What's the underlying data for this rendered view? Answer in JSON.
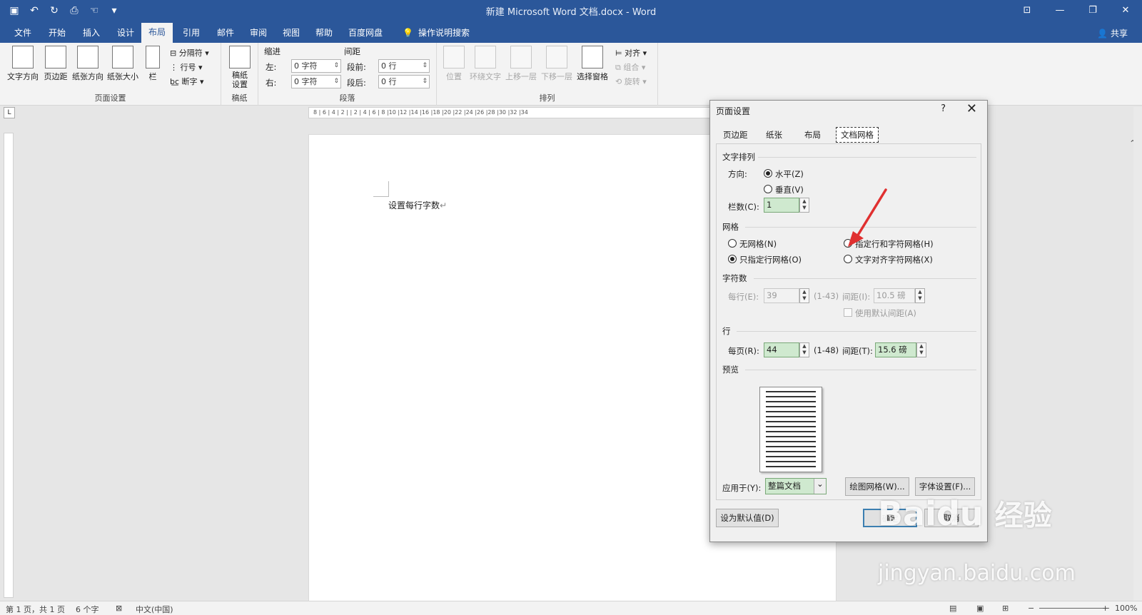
{
  "window": {
    "title": "新建 Microsoft Word 文档.docx  -  Word",
    "share": "共享"
  },
  "menu": {
    "tabs": [
      "文件",
      "开始",
      "插入",
      "设计",
      "布局",
      "引用",
      "邮件",
      "审阅",
      "视图",
      "帮助",
      "百度网盘"
    ],
    "active": "布局",
    "tellme": "操作说明搜索"
  },
  "ribbon": {
    "page_setup": {
      "label": "页面设置",
      "text_dir": "文字方向",
      "margins": "页边距",
      "orientation": "纸张方向",
      "size": "纸张大小",
      "columns": "栏",
      "breaks": "分隔符",
      "line_numbers": "行号",
      "hyphenation": "断字"
    },
    "manuscript": {
      "label": "稿纸",
      "setup": "稿纸\n设置"
    },
    "paragraph": {
      "label": "段落",
      "indent": "缩进",
      "spacing": "间距",
      "left_label": "左:",
      "left_val": "0 字符",
      "right_label": "右:",
      "right_val": "0 字符",
      "before_label": "段前:",
      "before_val": "0 行",
      "after_label": "段后:",
      "after_val": "0 行"
    },
    "arrange": {
      "label": "排列",
      "position": "位置",
      "wrap": "环绕文字",
      "forward": "上移一层",
      "backward": "下移一层",
      "selection_pane": "选择窗格",
      "align": "对齐",
      "group": "组合",
      "rotate": "旋转"
    }
  },
  "ruler": {
    "marks": "8 | 6 | 4 | 2 |   | 2 | 4 | 6 | 8 |10 |12 |14 |16 |18 |20 |22 |24 |26 |28 |30 |32 |34"
  },
  "document": {
    "text": "设置每行字数"
  },
  "status": {
    "page": "第 1 页，共 1 页",
    "words": "6 个字",
    "lang": "中文(中国)",
    "zoom": "100%"
  },
  "dialog": {
    "title": "页面设置",
    "help": "?",
    "tabs": [
      "页边距",
      "纸张",
      "布局",
      "文档网格"
    ],
    "active_tab": "文档网格",
    "text_layout": {
      "title": "文字排列",
      "direction_label": "方向:",
      "horizontal": "水平(Z)",
      "vertical": "垂直(V)",
      "columns_label": "栏数(C):",
      "columns_value": "1"
    },
    "grid": {
      "title": "网格",
      "none": "无网格(N)",
      "lines_only": "只指定行网格(O)",
      "lines_chars": "指定行和字符网格(H)",
      "snap_chars": "文字对齐字符网格(X)",
      "selected": "只指定行网格(O)"
    },
    "chars": {
      "title": "字符数",
      "per_line_label": "每行(E):",
      "per_line_value": "39",
      "per_line_range": "(1-43)",
      "pitch_label": "间距(I):",
      "pitch_value": "10.5 磅",
      "default_pitch": "使用默认间距(A)"
    },
    "lines": {
      "title": "行",
      "per_page_label": "每页(R):",
      "per_page_value": "44",
      "per_page_range": "(1-48)",
      "pitch_label": "间距(T):",
      "pitch_value": "15.6 磅"
    },
    "preview_title": "预览",
    "apply_label": "应用于(Y):",
    "apply_value": "整篇文档",
    "draw_grid": "绘图网格(W)...",
    "font_settings": "字体设置(F)...",
    "set_default": "设为默认值(D)",
    "ok": "确定",
    "cancel": "取消"
  },
  "watermark": {
    "brand": "Baidu",
    "brand_cn": "经验",
    "url": "jingyan.baidu.com"
  },
  "colors": {
    "accent": "#2b579a",
    "field_green": "#cfe9cf",
    "arrow": "#e03030"
  }
}
